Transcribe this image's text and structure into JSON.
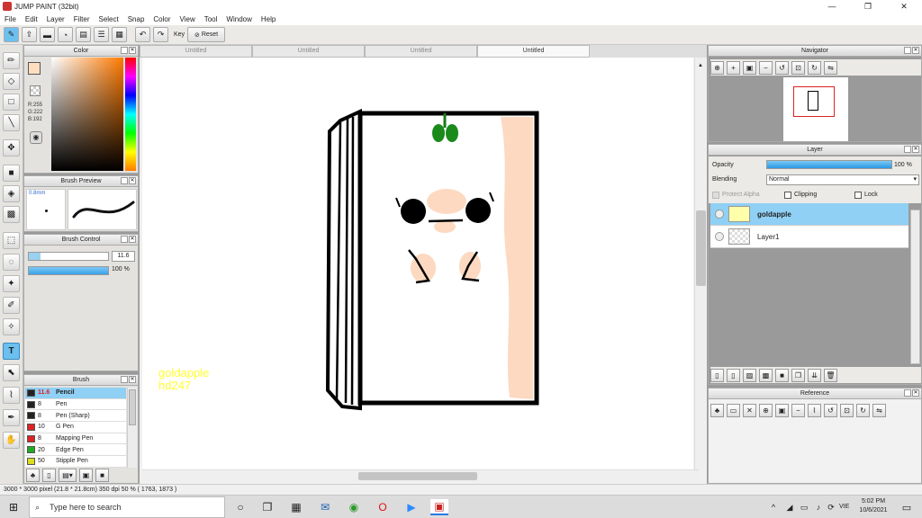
{
  "app": {
    "title": "JUMP PAINT (32bit)",
    "window_controls": [
      "—",
      "❐",
      "✕"
    ]
  },
  "menu": [
    "File",
    "Edit",
    "Layer",
    "Filter",
    "Select",
    "Snap",
    "Color",
    "View",
    "Tool",
    "Window",
    "Help"
  ],
  "toolbar": {
    "key_label": "Key",
    "reset_label": "Reset"
  },
  "tabs": [
    {
      "label": "Untitled",
      "active": false
    },
    {
      "label": "Untitled",
      "active": false
    },
    {
      "label": "Untitled",
      "active": false
    },
    {
      "label": "Untitled",
      "active": true
    }
  ],
  "color_panel": {
    "title": "Color",
    "r": "R:255",
    "g": "G:222",
    "b": "B:192",
    "fg_color": "#ffdec0",
    "bg_color": "#2aa12a",
    "hue_color": "#ff7a00"
  },
  "brush_preview": {
    "title": "Brush Preview",
    "size_label": "0.8mm"
  },
  "brush_control": {
    "title": "Brush Control",
    "size_value": "11.6",
    "opacity_value": "100 %",
    "size_fraction": 0.15,
    "opacity_fraction": 1.0
  },
  "brush_panel": {
    "title": "Brush",
    "items": [
      {
        "size": "11.6",
        "name": "Pencil",
        "color": "#222222",
        "selected": true
      },
      {
        "size": "8",
        "name": "Pen",
        "color": "#222222",
        "selected": false
      },
      {
        "size": "8",
        "name": "Pen (Sharp)",
        "color": "#222222",
        "selected": false
      },
      {
        "size": "10",
        "name": "G Pen",
        "color": "#dd2222",
        "selected": false
      },
      {
        "size": "8",
        "name": "Mapping Pen",
        "color": "#dd2222",
        "selected": false
      },
      {
        "size": "20",
        "name": "Edge Pen",
        "color": "#22aa22",
        "selected": false
      },
      {
        "size": "50",
        "name": "Stipple Pen",
        "color": "#dddd22",
        "selected": false
      }
    ]
  },
  "canvas": {
    "watermark_line1": "goldapple",
    "watermark_line2": "hd247",
    "watermark_color": "#ffff33"
  },
  "navigator": {
    "title": "Navigator"
  },
  "layer_panel": {
    "title": "Layer",
    "opacity_label": "Opacity",
    "opacity_value": "100 %",
    "opacity_fraction": 1.0,
    "blending_label": "Blending",
    "blending_value": "Normal",
    "protect_alpha_label": "Protect Alpha",
    "clipping_label": "Clipping",
    "lock_label": "Lock",
    "layers": [
      {
        "name": "goldapple",
        "selected": true
      },
      {
        "name": "Layer1",
        "selected": false
      }
    ]
  },
  "reference_panel": {
    "title": "Reference"
  },
  "status": {
    "text": "3000 * 3000 pixel  (21.8 * 21.8cm)  350 dpi  50 %  ( 1763, 1873 )"
  },
  "taskbar": {
    "search_placeholder": "Type here to search",
    "time": "5:02 PM",
    "date": "10/6/2021",
    "lang": "VIE"
  }
}
